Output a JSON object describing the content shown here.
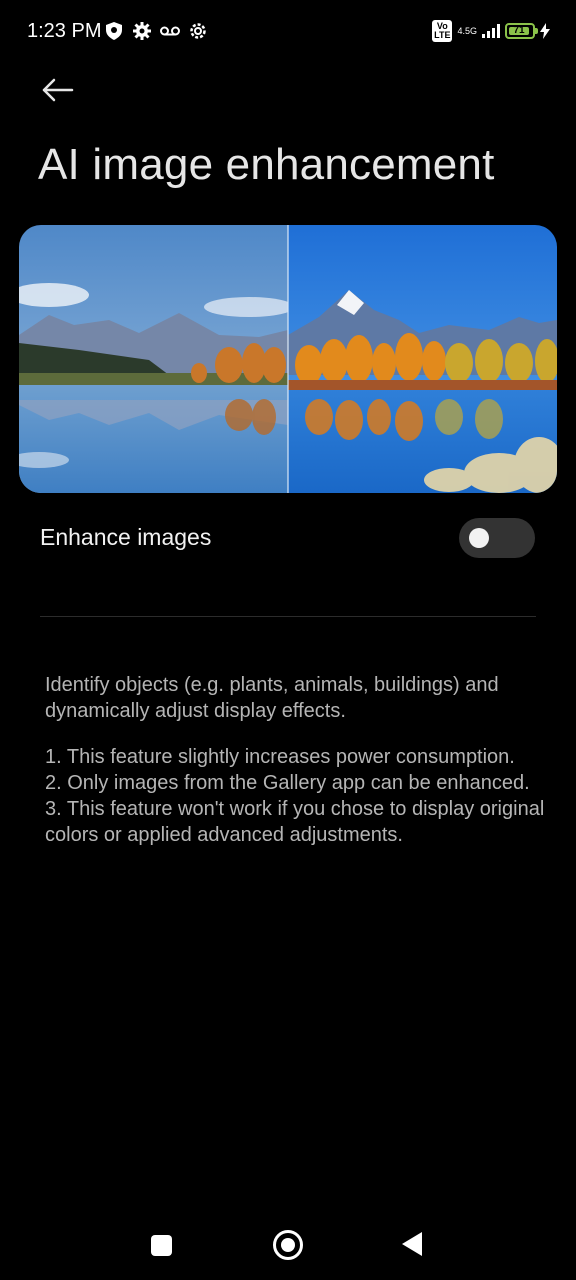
{
  "status_bar": {
    "time": "1:23 PM",
    "left_icons": [
      "shield-icon",
      "gear-icon",
      "voicemail-icon",
      "settings-cog-icon"
    ],
    "volte": "Vo\nLTE",
    "network": "4.5G",
    "battery_level": "71"
  },
  "header": {
    "title": "AI image enhancement"
  },
  "setting": {
    "label": "Enhance images",
    "enabled": false
  },
  "description": {
    "intro": "Identify objects (e.g. plants, animals, buildings) and dynamically adjust display effects.",
    "notes": [
      "1. This feature slightly increases power consumption.",
      "2. Only images from the Gallery app can be enhanced.",
      "3. This feature won't work if you chose to display original colors or applied advanced adjustments."
    ]
  },
  "nav": {
    "recents": "recents-button",
    "home": "home-button",
    "back": "back-nav-button"
  }
}
